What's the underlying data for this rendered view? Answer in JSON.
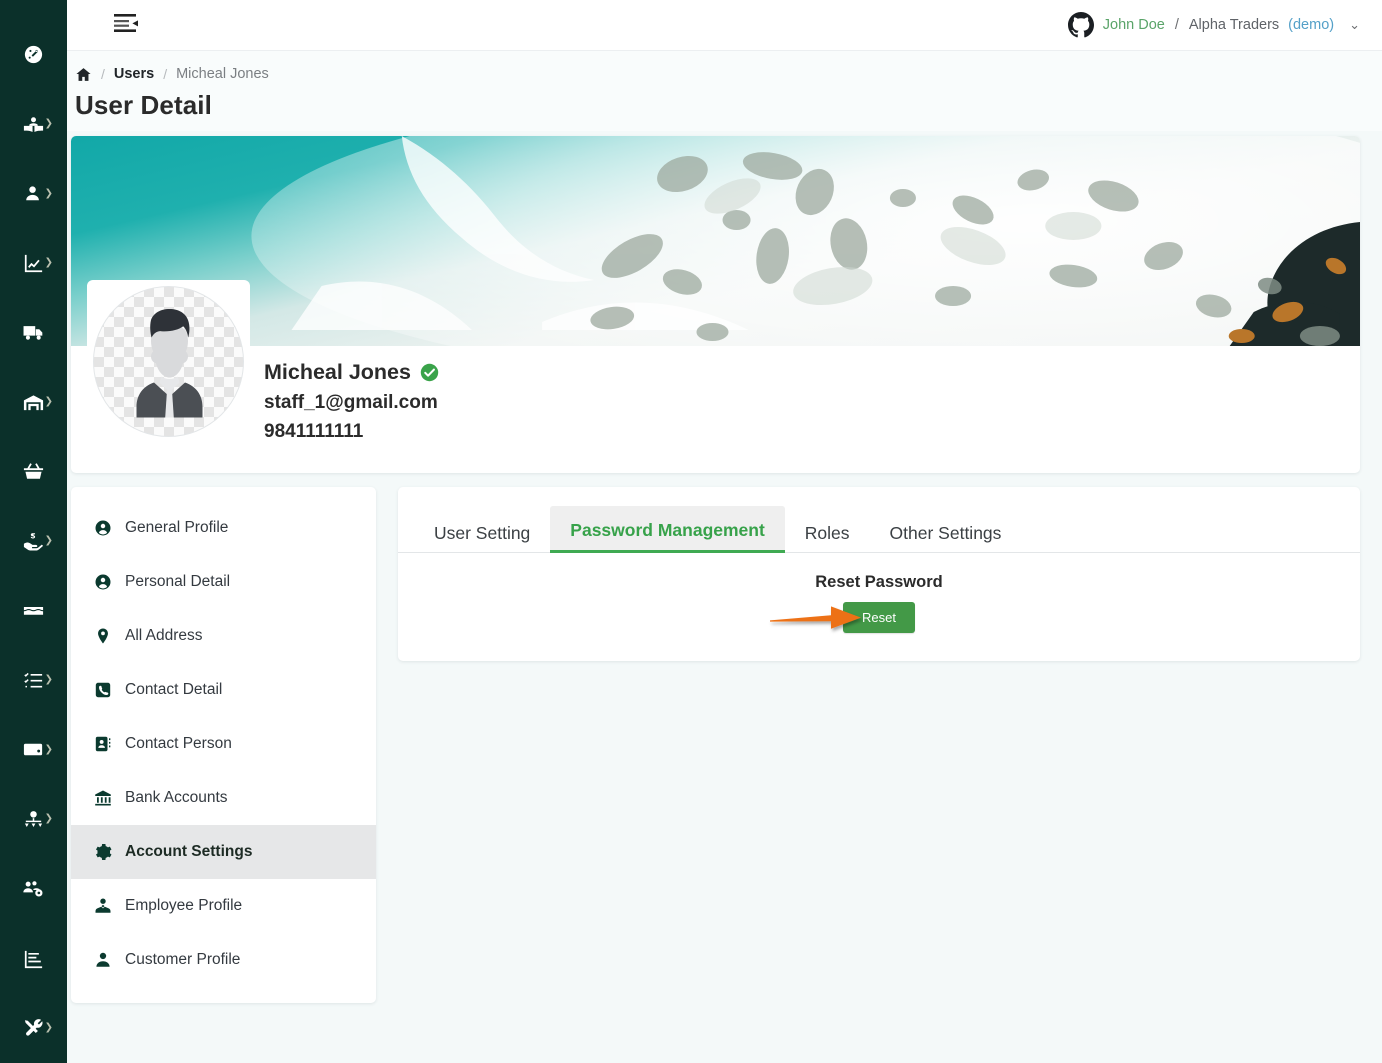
{
  "rail": {
    "items": [
      {
        "name": "dashboard",
        "icon": "gauge-icon",
        "caret": false
      },
      {
        "name": "catalog",
        "icon": "book-user-icon",
        "caret": true
      },
      {
        "name": "contacts",
        "icon": "user-badge-icon",
        "caret": true
      },
      {
        "name": "reports",
        "icon": "chart-line-icon",
        "caret": true
      },
      {
        "name": "delivery",
        "icon": "truck-icon",
        "caret": false
      },
      {
        "name": "warehouse",
        "icon": "warehouse-icon",
        "caret": true
      },
      {
        "name": "sales",
        "icon": "basket-icon",
        "caret": false
      },
      {
        "name": "payments",
        "icon": "hand-money-icon",
        "caret": true
      },
      {
        "name": "inventory",
        "icon": "boxes-icon",
        "caret": false
      },
      {
        "name": "tasks",
        "icon": "checklist-icon",
        "caret": true
      },
      {
        "name": "accounts",
        "icon": "wallet-icon",
        "caret": true
      },
      {
        "name": "organization",
        "icon": "org-chart-icon",
        "caret": true
      },
      {
        "name": "users",
        "icon": "users-cog-icon",
        "caret": false
      },
      {
        "name": "analytics",
        "icon": "bar-chart-icon",
        "caret": false
      },
      {
        "name": "tools",
        "icon": "tools-icon",
        "caret": true
      }
    ]
  },
  "topbar": {
    "collapse_icon": "collapse-sidebar-icon",
    "account_icon": "github-mark-icon",
    "user_name": "John Doe",
    "separator": "/",
    "organization": "Alpha Traders",
    "environment": "(demo)",
    "chevron": "⌄"
  },
  "breadcrumb": {
    "home_icon": "home-icon",
    "sep": "/",
    "items": [
      {
        "label": "Users",
        "current": false
      },
      {
        "label": "Micheal Jones",
        "current": true
      }
    ]
  },
  "page": {
    "title": "User Detail"
  },
  "profile": {
    "banner_alt": "ocean-waves-banner",
    "avatar_alt": "default-user-avatar",
    "name": "Micheal Jones",
    "verified_icon": "verified-check-icon",
    "email": "staff_1@gmail.com",
    "phone": "9841111111"
  },
  "side_menu": {
    "items": [
      {
        "label": "General Profile",
        "icon": "user-circle-icon",
        "active": false
      },
      {
        "label": "Personal Detail",
        "icon": "user-circle-icon",
        "active": false
      },
      {
        "label": "All Address",
        "icon": "map-pin-icon",
        "active": false
      },
      {
        "label": "Contact Detail",
        "icon": "phone-square-icon",
        "active": false
      },
      {
        "label": "Contact Person",
        "icon": "id-card-icon",
        "active": false
      },
      {
        "label": "Bank Accounts",
        "icon": "bank-icon",
        "active": false
      },
      {
        "label": "Account Settings",
        "icon": "gear-icon",
        "active": true
      },
      {
        "label": "Employee Profile",
        "icon": "user-tie-icon",
        "active": false
      },
      {
        "label": "Customer Profile",
        "icon": "user-solid-icon",
        "active": false
      }
    ]
  },
  "tabs": {
    "items": [
      {
        "label": "User Setting",
        "active": false
      },
      {
        "label": "Password Management",
        "active": true
      },
      {
        "label": "Roles",
        "active": false
      },
      {
        "label": "Other Settings",
        "active": false
      }
    ]
  },
  "panel": {
    "title": "Reset Password",
    "reset_button": "Reset",
    "annotation_icon": "orange-arrow-annotation"
  },
  "colors": {
    "rail_bg": "#0b302a",
    "page_bg": "#f4f9f9",
    "accent_green": "#37a24a",
    "button_green": "#439947",
    "annotation_orange": "#ED7117",
    "verified_green": "#3aa34a",
    "user_name_green": "#5aa469",
    "demo_blue": "#54a0c8"
  }
}
